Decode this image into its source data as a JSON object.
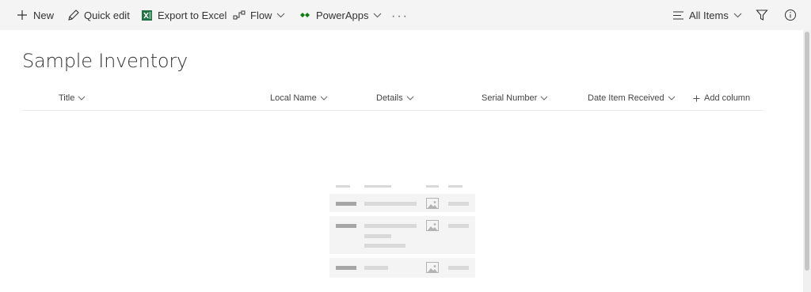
{
  "commandbar": {
    "new_label": "New",
    "quick_edit_label": "Quick edit",
    "export_label": "Export to Excel",
    "flow_label": "Flow",
    "powerapps_label": "PowerApps",
    "more_label": "···",
    "view_label": "All Items"
  },
  "list": {
    "title": "Sample Inventory",
    "columns": [
      "Title",
      "Local Name",
      "Details",
      "Serial Number",
      "Date Item Received"
    ],
    "add_column_label": "Add column"
  },
  "colors": {
    "accent_green": "#107c10",
    "excel_green": "#217346",
    "placeholder_dark": "#a6a6a6",
    "placeholder_light": "#d9d9d9"
  }
}
